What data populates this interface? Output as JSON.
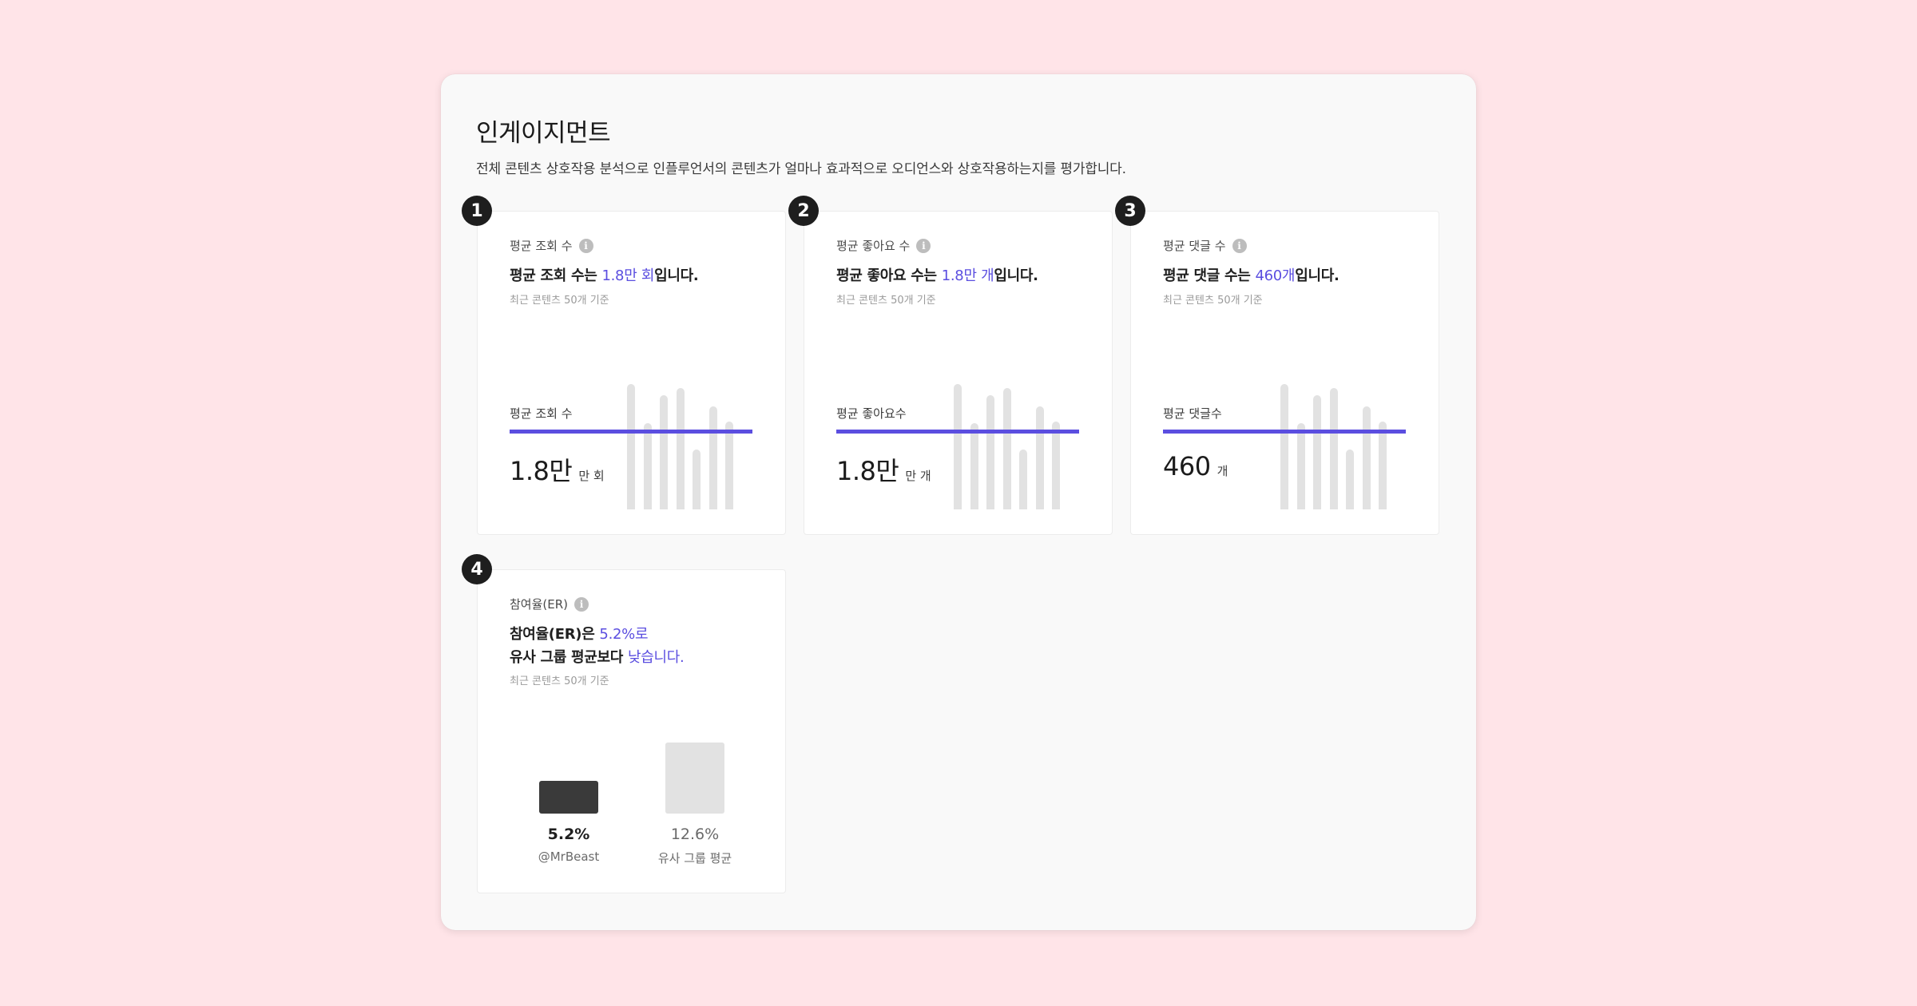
{
  "page": {
    "title": "인게이지먼트",
    "description": "전체 콘텐츠 상호작용 분석으로 인플루언서의 콘텐츠가 얼마나 효과적으로 오디언스와 상호작용하는지를 평가합니다."
  },
  "colors": {
    "accent": "#5b4ee0",
    "bar_gray": "#e2e2e2",
    "dark_bar": "#3a3a3a",
    "background": "#ffe4e8"
  },
  "cards": [
    {
      "badge": "1",
      "label": "평균 조회 수",
      "headline_pre": "평균 조회 수는 ",
      "headline_accent": "1.8만 회",
      "headline_post": "입니다.",
      "note": "최근 콘텐츠 50개 기준",
      "metric_label": "평균 조회 수",
      "metric_value": "1.8만",
      "metric_unit": "만 회",
      "bar_levels": [
        1.0,
        0.69,
        0.91,
        0.97,
        0.48,
        0.82,
        0.7
      ]
    },
    {
      "badge": "2",
      "label": "평균 좋아요 수",
      "headline_pre": "평균 좋아요 수는 ",
      "headline_accent": "1.8만 개",
      "headline_post": "입니다.",
      "note": "최근 콘텐츠 50개 기준",
      "metric_label": "평균 좋아요수",
      "metric_value": "1.8만",
      "metric_unit": "만 개",
      "bar_levels": [
        1.0,
        0.69,
        0.91,
        0.97,
        0.48,
        0.82,
        0.7
      ]
    },
    {
      "badge": "3",
      "label": "평균 댓글 수",
      "headline_pre": "평균 댓글 수는 ",
      "headline_accent": "460개",
      "headline_post": "입니다.",
      "note": "최근 콘텐츠 50개 기준",
      "metric_label": "평균 댓글수",
      "metric_value": "460",
      "metric_unit": "개",
      "bar_levels": [
        1.0,
        0.69,
        0.91,
        0.97,
        0.48,
        0.82,
        0.7
      ]
    }
  ],
  "er_card": {
    "badge": "4",
    "label": "참여율(ER)",
    "headline_line1_pre": "참여율(ER)은 ",
    "headline_line1_accent": "5.2%로",
    "headline_line2_pre": "유사 그룹 평균보다 ",
    "headline_line2_accent": "낮습니다.",
    "note": "최근 콘텐츠 50개 기준",
    "self_value": "5.2%",
    "self_name": "@MrBeast",
    "self_level": 0.46,
    "group_value": "12.6%",
    "group_name": "유사 그룹 평균",
    "group_level": 1.0
  }
}
